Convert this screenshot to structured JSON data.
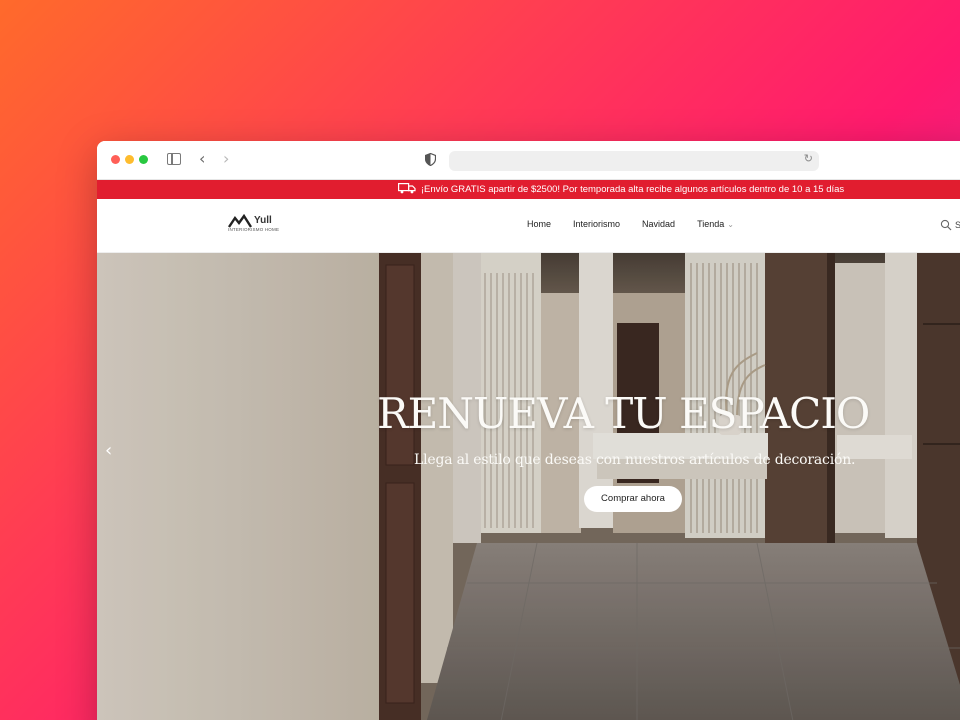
{
  "promo_bar": {
    "text": "¡Envío GRATIS apartir de $2500! Por temporada alta recibe algunos artículos dentro de 10 a 15 días",
    "icon": "truck-icon"
  },
  "header": {
    "logo_name": "Yull",
    "logo_tagline": "INTERIORISMO HOME",
    "menu": [
      {
        "label": "Home"
      },
      {
        "label": "Interiorismo"
      },
      {
        "label": "Navidad"
      },
      {
        "label": "Tienda"
      }
    ],
    "search_label": "S"
  },
  "hero": {
    "title": "RENUEVA TU ESPACIO",
    "subtitle": "Llega al estilo que deseas con nuestros artículos de decoración.",
    "cta_label": "Comprar ahora"
  },
  "browser": {
    "back_icon": "chevron-left-icon",
    "forward_icon": "chevron-right-icon",
    "reload_icon": "reload-icon"
  },
  "colors": {
    "promo_bg": "#e11d2f",
    "accent_gradient_start": "#ff6a2b",
    "accent_gradient_end": "#c52aa8"
  }
}
